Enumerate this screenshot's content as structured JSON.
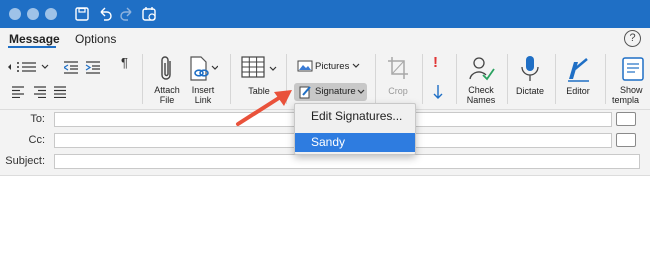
{
  "colors": {
    "titlebar": "#1f6fc5",
    "selection": "#2e7ce0",
    "annotation_arrow": "#e9523b"
  },
  "tabs": [
    {
      "label": "Message",
      "active": true
    },
    {
      "label": "Options",
      "active": false
    }
  ],
  "help": {
    "label": "?"
  },
  "ribbon": {
    "paragraph_mark": "¶",
    "attach_file": "Attach\nFile",
    "attach_line1": "Attach",
    "attach_line2": "File",
    "insert_line1": "Insert",
    "insert_line2": "Link",
    "table": "Table",
    "pictures": "Pictures",
    "signature": "Signature",
    "crop": "Crop",
    "importance_high": "!",
    "check_line1": "Check",
    "check_line2": "Names",
    "dictate": "Dictate",
    "editor": "Editor",
    "show_line1": "Show",
    "show_line2": "templa"
  },
  "fields": {
    "to_label": "To:",
    "cc_label": "Cc:",
    "subject_label": "Subject:"
  },
  "signature_menu": {
    "items": [
      {
        "label": "Edit Signatures...",
        "selected": false
      },
      {
        "label": "Sandy",
        "selected": true
      }
    ]
  }
}
